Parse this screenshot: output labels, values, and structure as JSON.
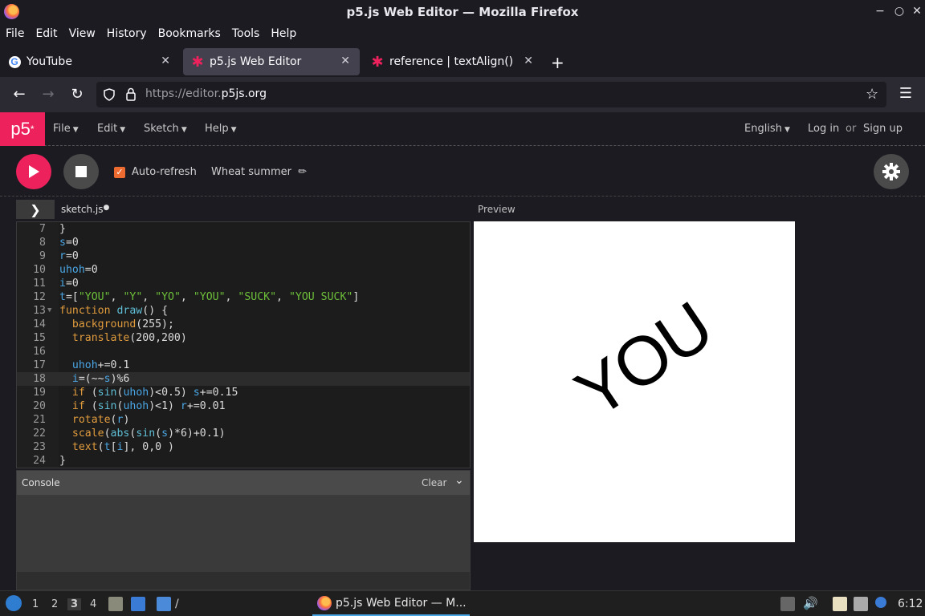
{
  "window": {
    "title": "p5.js Web Editor — Mozilla Firefox"
  },
  "menubar": [
    "File",
    "Edit",
    "View",
    "History",
    "Bookmarks",
    "Tools",
    "Help"
  ],
  "tabs": [
    {
      "label": "YouTube",
      "active": false
    },
    {
      "label": "p5.js Web Editor",
      "active": true
    },
    {
      "label": "reference | textAlign()",
      "active": false
    }
  ],
  "urlbar": {
    "prefix": "https://editor.",
    "domain": "p5js.org"
  },
  "p5": {
    "logo": "p5",
    "menu": [
      "File",
      "Edit",
      "Sketch",
      "Help"
    ],
    "language": "English",
    "login": "Log in",
    "or": "or",
    "signup": "Sign up",
    "autorefresh": "Auto-refresh",
    "sketch_name": "Wheat summer",
    "file_tab": "sketch.js",
    "preview_label": "Preview",
    "console_label": "Console",
    "clear_label": "Clear",
    "preview_text": "YOU"
  },
  "code_lines": [
    {
      "n": "7",
      "html": "}"
    },
    {
      "n": "8",
      "html": "<span class='v'>s</span>=0"
    },
    {
      "n": "9",
      "html": "<span class='v'>r</span>=0"
    },
    {
      "n": "10",
      "html": "<span class='v'>uhoh</span>=0"
    },
    {
      "n": "11",
      "html": "<span class='v'>i</span>=0"
    },
    {
      "n": "12",
      "html": "<span class='v'>t</span>=[<span class='s'>\"YOU\"</span>, <span class='s'>\"Y\"</span>, <span class='s'>\"YO\"</span>, <span class='s'>\"YOU\"</span>, <span class='s'>\"SUCK\"</span>, <span class='s'>\"YOU SUCK\"</span>]"
    },
    {
      "n": "13",
      "html": "<span class='kw'>function</span> <span class='f'>draw</span>() {",
      "fold": true
    },
    {
      "n": "14",
      "html": "  <span class='kw'>background</span>(255);"
    },
    {
      "n": "15",
      "html": "  <span class='kw'>translate</span>(200,200)"
    },
    {
      "n": "16",
      "html": ""
    },
    {
      "n": "17",
      "html": "  <span class='v'>uhoh</span>+=0.1"
    },
    {
      "n": "18",
      "html": "  <span class='v'>i</span>=(~~<span class='v'>s</span>)%6",
      "hl": true
    },
    {
      "n": "19",
      "html": "  <span class='kw'>if</span> (<span class='f'>sin</span>(<span class='v'>uhoh</span>)<0.5) <span class='v'>s</span>+=0.15"
    },
    {
      "n": "20",
      "html": "  <span class='kw'>if</span> (<span class='f'>sin</span>(<span class='v'>uhoh</span>)<1) <span class='v'>r</span>+=0.01"
    },
    {
      "n": "21",
      "html": "  <span class='kw'>rotate</span>(<span class='v'>r</span>)"
    },
    {
      "n": "22",
      "html": "  <span class='kw'>scale</span>(<span class='f'>abs</span>(<span class='f'>sin</span>(<span class='v'>s</span>)*6)+0.1)"
    },
    {
      "n": "23",
      "html": "  <span class='kw'>text</span>(<span class='v'>t</span>[<span class='v'>i</span>], 0,0 )"
    },
    {
      "n": "24",
      "html": "}"
    }
  ],
  "taskbar": {
    "workspaces": [
      "1",
      "2",
      "3",
      "4"
    ],
    "active_workspace": "3",
    "task_label": "p5.js Web Editor — M...",
    "clock": "6:12"
  }
}
